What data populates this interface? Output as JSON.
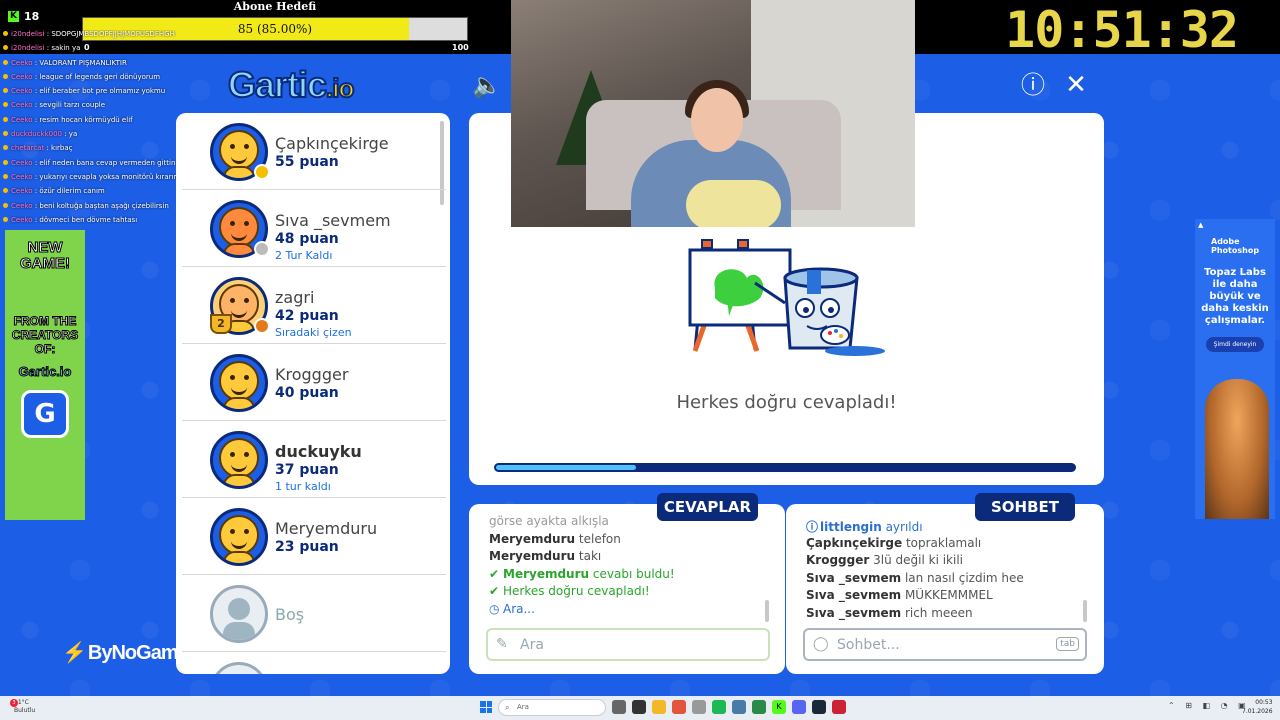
{
  "overlay": {
    "viewer_count": "18",
    "goal_title": "Abone Hedefi",
    "goal_text": "85 (85.00%)",
    "goal_fraction": 0.85,
    "goal_min": "0",
    "goal_max": "100",
    "clock": "10:51:32"
  },
  "stream_chat": [
    {
      "user": "i20ndelisi",
      "text": "SDOPGJMBSDOPFJJHJMOPÜSDFHGH"
    },
    {
      "user": "i20ndelisi",
      "text": "sakin ya"
    },
    {
      "user": "Ceeko",
      "text": "VALORANT PİŞMANLIKTIR"
    },
    {
      "user": "Ceeko",
      "text": "league of legends geri dönüyorum"
    },
    {
      "user": "Ceeko",
      "text": "elif beraber bot pre olmamız yokmu"
    },
    {
      "user": "Ceeko",
      "text": "sevgili tarzı couple"
    },
    {
      "user": "Ceeko",
      "text": "resim hocan körmüydü elif"
    },
    {
      "user": "duckduckk000",
      "text": "ya"
    },
    {
      "user": "chetarcat",
      "text": "kırbaç"
    },
    {
      "user": "Ceeko",
      "text": "elif neden bana cevap vermeden gittin"
    },
    {
      "user": "Ceeko",
      "text": "yukarıyı cevapla yoksa monitörü kırarım"
    },
    {
      "user": "Ceeko",
      "text": "özür dilerim canım"
    },
    {
      "user": "Ceeko",
      "text": "beni koltuğa baştan aşağı çizebilirsin"
    },
    {
      "user": "Ceeko",
      "text": "dövmeci ben dövme tahtası"
    }
  ],
  "left_ad": {
    "line1": "NEW GAME!",
    "line2": "FROM THE CREATORS OF:",
    "brand": "Gartic.io",
    "badge": "G"
  },
  "watermark": "ByNoGame",
  "game": {
    "logo_main": "Gartic",
    "logo_suffix": ".io",
    "sound_icon": "🔈",
    "info_icon": "ⓘ",
    "close_icon": "✕"
  },
  "players": [
    {
      "name": "Çapkınçekirge",
      "points": "55 puan",
      "sub": "",
      "dot_color": "#f5c000",
      "avatar": "default"
    },
    {
      "name": "Sıva _sevmem",
      "points": "48 puan",
      "sub": "2 Tur Kaldı",
      "dot_color": "#bbbbbb",
      "avatar": "orange"
    },
    {
      "name": "zagri",
      "points": "42 puan",
      "sub": "Sıradaki çizen",
      "dot_color": "#e27a1c",
      "avatar": "zagri",
      "trophy": "2"
    },
    {
      "name": "Kroggger",
      "points": "40 puan",
      "sub": "",
      "avatar": "default"
    },
    {
      "name": "duckuyku",
      "points": "37 puan",
      "sub": "1 tur kaldı",
      "avatar": "default",
      "bold": true
    },
    {
      "name": "Meryemduru",
      "points": "23 puan",
      "sub": "",
      "avatar": "default"
    },
    {
      "name": "Boş",
      "points": "",
      "sub": "",
      "avatar": "empty"
    }
  ],
  "round": {
    "result_text": "Herkes doğru cevapladı!",
    "timer_fraction": 0.24
  },
  "answers": {
    "tab_label": "CEVAPLAR",
    "placeholder": "Ara",
    "messages": [
      {
        "name": "",
        "text": "görse ayakta alkışla",
        "kind": "faded"
      },
      {
        "name": "Meryemduru",
        "text": "telefon",
        "kind": "normal"
      },
      {
        "name": "Meryemduru",
        "text": "takı",
        "kind": "normal"
      },
      {
        "name": "Meryemduru",
        "text": "cevabı buldu!",
        "kind": "correct"
      },
      {
        "name": "",
        "text": "Herkes doğru cevapladı!",
        "kind": "correct"
      },
      {
        "name": "",
        "text": "Ara...",
        "kind": "info-clock"
      }
    ]
  },
  "chat": {
    "tab_label": "SOHBET",
    "placeholder": "Sohbet...",
    "tab_key": "tab",
    "messages": [
      {
        "name": "littlengin",
        "text": "ayrıldı",
        "kind": "info"
      },
      {
        "name": "Çapkınçekirge",
        "text": "topraklamalı",
        "kind": "normal"
      },
      {
        "name": "Kroggger",
        "text": "3lü değil ki ikili",
        "kind": "normal"
      },
      {
        "name": "Sıva _sevmem",
        "text": "lan nasıl çizdim hee",
        "kind": "normal"
      },
      {
        "name": "Sıva _sevmem",
        "text": "MÜKKEMMMEL",
        "kind": "normal"
      },
      {
        "name": "Sıva _sevmem",
        "text": "rich meeen",
        "kind": "normal"
      }
    ]
  },
  "right_ad": {
    "brand_line1": "Adobe",
    "brand_line2": "Photoshop",
    "text": "Topaz Labs ile daha büyük ve daha keskin çalışmalar.",
    "button": "Şimdi deneyin"
  },
  "taskbar": {
    "weather_temp": "11°C",
    "weather_desc": "Bulutlu",
    "search_placeholder": "Ara",
    "time": "00:53",
    "date": "7.01.2026"
  }
}
